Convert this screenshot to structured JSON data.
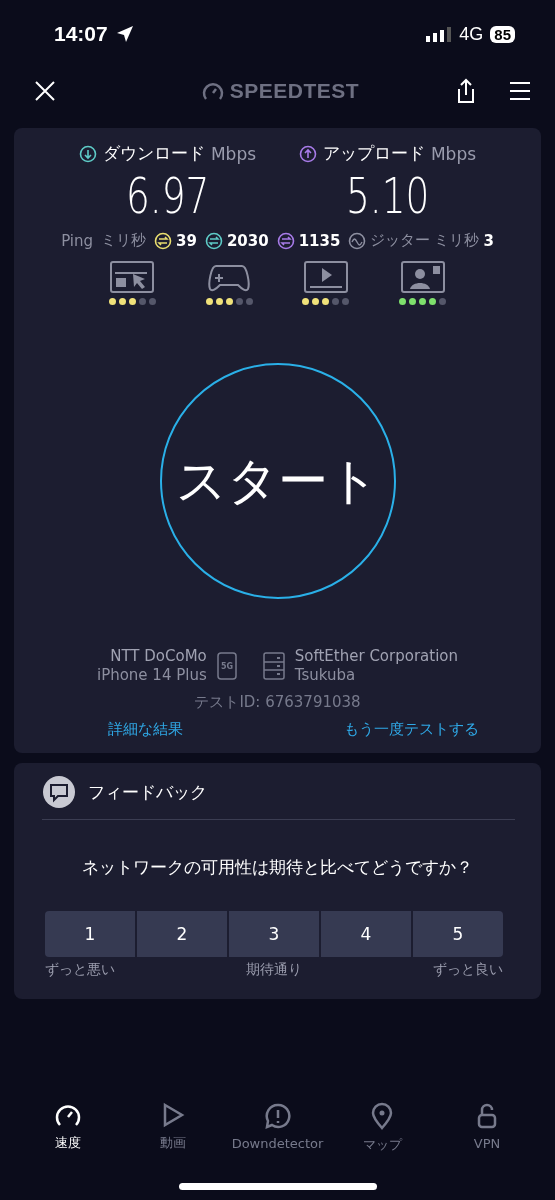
{
  "status_bar": {
    "time": "14:07",
    "network": "4G",
    "battery": "85"
  },
  "header": {
    "logo": "SPEEDTEST"
  },
  "results": {
    "download": {
      "label": "ダウンロード",
      "unit": "Mbps",
      "value": "6.97"
    },
    "upload": {
      "label": "アップロード",
      "unit": "Mbps",
      "value": "5.10"
    },
    "ping": {
      "label": "Ping",
      "unit": "ミリ秒",
      "values": [
        {
          "value": "39",
          "color": "#e9de6f"
        },
        {
          "value": "2030",
          "color": "#5ecbc7"
        },
        {
          "value": "1135",
          "color": "#a77be8"
        }
      ]
    },
    "jitter": {
      "label": "ジッター",
      "unit": "ミリ秒",
      "value": "3"
    },
    "quality": [
      {
        "kind": "browsing",
        "stars": 3,
        "color": "#f0e27a"
      },
      {
        "kind": "gaming",
        "stars": 3,
        "color": "#f0e27a"
      },
      {
        "kind": "video",
        "stars": 3,
        "color": "#f0e27a"
      },
      {
        "kind": "call",
        "stars": 4,
        "color": "#7ee06c"
      }
    ]
  },
  "start_button": "スタート",
  "provider": {
    "name": "NTT DoCoMo",
    "device": "iPhone 14 Plus",
    "network_badge": "5G"
  },
  "server": {
    "name": "SoftEther Corporation",
    "location": "Tsukuba"
  },
  "test_id": "テストID: 6763791038",
  "links": [
    "詳細な結果",
    "もう一度テストする"
  ],
  "feedback": {
    "title": "フィードバック",
    "question": "ネットワークの可用性は期待と比べてどうですか？",
    "options": [
      "1",
      "2",
      "3",
      "4",
      "5"
    ],
    "scale_labels": [
      "ずっと悪い",
      "期待通り",
      "ずっと良い"
    ]
  },
  "tabs": [
    {
      "label": "速度",
      "kind": "speed",
      "selected": true
    },
    {
      "label": "動画",
      "kind": "video",
      "selected": false
    },
    {
      "label": "Downdetector",
      "kind": "alert",
      "selected": false
    },
    {
      "label": "マップ",
      "kind": "map",
      "selected": false
    },
    {
      "label": "VPN",
      "kind": "lock",
      "selected": false
    }
  ]
}
